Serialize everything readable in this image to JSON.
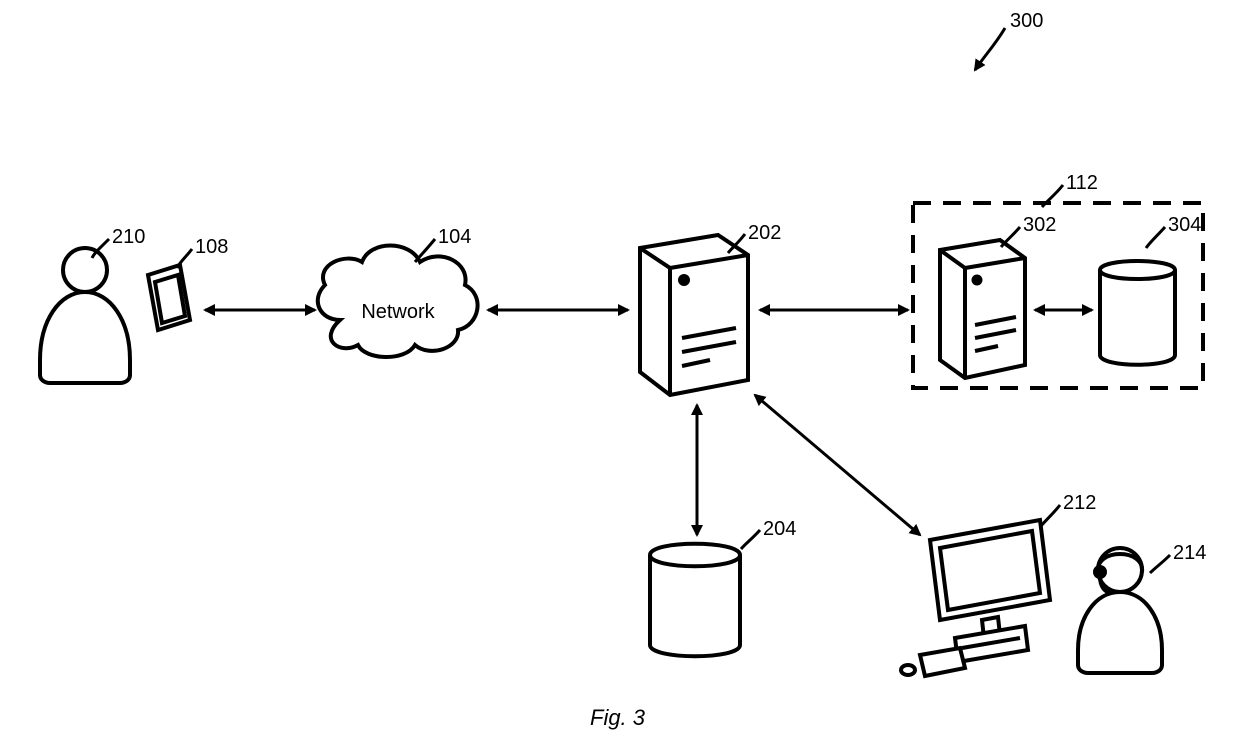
{
  "figure": {
    "caption": "Fig. 3",
    "ref_300": "300",
    "ref_210": "210",
    "ref_108": "108",
    "ref_104": "104",
    "ref_202": "202",
    "ref_112": "112",
    "ref_302": "302",
    "ref_304": "304",
    "ref_204": "204",
    "ref_212": "212",
    "ref_214": "214",
    "cloud_label": "Network"
  }
}
